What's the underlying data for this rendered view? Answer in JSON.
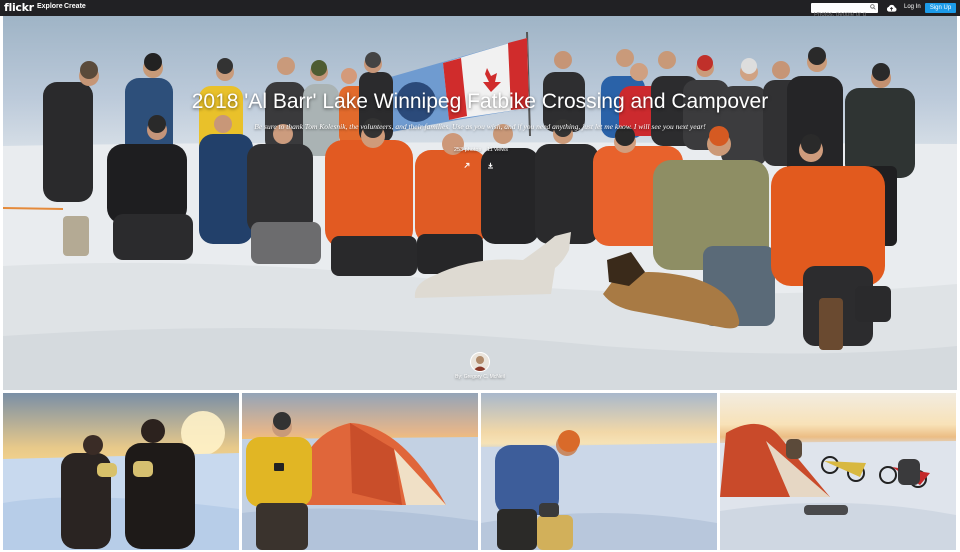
{
  "header": {
    "logo": "flickr",
    "nav": [
      "Explore",
      "Create"
    ],
    "search_placeholder": "Photos, people or groups",
    "login_label": "Log In",
    "signup_label": "Sign Up"
  },
  "album": {
    "title": "2018 'Al Barr' Lake Winnipeg Fatbike Crossing and Campover",
    "description": "Be sure to thank Tom Kolesnik, the volunteers, and their families. Use as you wish, and if you need anything, just let me know. I will see you next year!",
    "photos_count": "253 photos",
    "views_count": "11 views",
    "author": "By: Gregory C. McNeil"
  },
  "colors": {
    "topbar": "#212124",
    "signup": "#1c9be9",
    "jacket_orange": "#e05a24",
    "tent_orange": "#e0663a",
    "sky_blue": "#9fb4c6"
  }
}
